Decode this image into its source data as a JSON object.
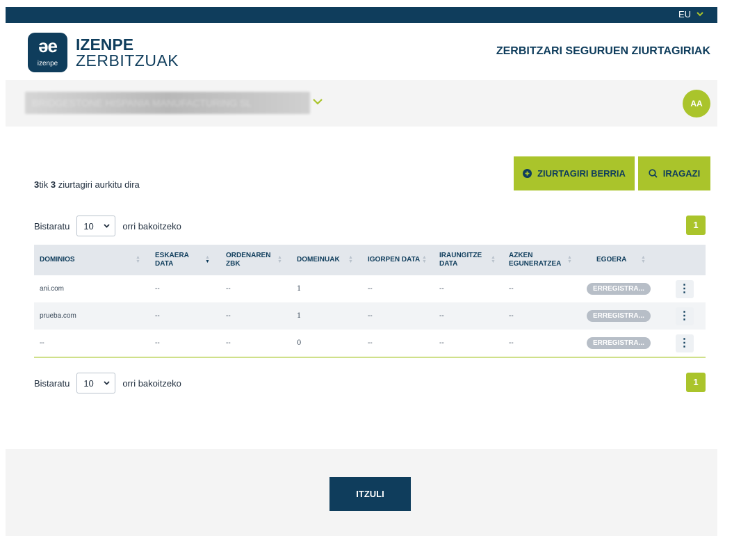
{
  "topbar": {
    "language": "EU"
  },
  "brand": {
    "logo_glyph": "əe",
    "logo_small": "izenpe",
    "line1": "IZENPE",
    "line2": "ZERBITZUAK"
  },
  "header": {
    "title": "ZERBITZARI SEGURUEN ZIURTAGIRIAK"
  },
  "org": {
    "name": "BRIDGESTONE HISPANIA MANUFACTURING SL",
    "avatar_initials": "AA"
  },
  "results": {
    "total": "3",
    "shown": "3",
    "mid": "tik ",
    "suffix": " ziurtagiri aurkitu dira"
  },
  "buttons": {
    "new_cert": "ZIURTAGIRI BERRIA",
    "filter": "IRAGAZI",
    "back": "ITZULI"
  },
  "pagination": {
    "prefix": "Bistaratu",
    "page_size": "10",
    "suffix": "orri bakoitzeko",
    "current_page": "1"
  },
  "table": {
    "columns": [
      {
        "l1": "DOMINIOS",
        "l2": ""
      },
      {
        "l1": "ESKAERA",
        "l2": "DATA"
      },
      {
        "l1": "ORDENAREN",
        "l2": "ZBK"
      },
      {
        "l1": "DOMEINUAK",
        "l2": ""
      },
      {
        "l1": "IGORPEN DATA",
        "l2": ""
      },
      {
        "l1": "IRAUNGITZE",
        "l2": "DATA"
      },
      {
        "l1": "AZKEN",
        "l2": "EGUNERATZEA"
      },
      {
        "l1": "EGOERA",
        "l2": ""
      }
    ],
    "rows": [
      {
        "dominios": "ani.com",
        "eskaera": "--",
        "ordenaren": "--",
        "domeinuak": "1",
        "igorpen": "--",
        "iraungitze": "--",
        "azken": "--",
        "egoera": "ERREGISTRA..."
      },
      {
        "dominios": "prueba.com",
        "eskaera": "--",
        "ordenaren": "--",
        "domeinuak": "1",
        "igorpen": "--",
        "iraungitze": "--",
        "azken": "--",
        "egoera": "ERREGISTRA..."
      },
      {
        "dominios": "--",
        "eskaera": "--",
        "ordenaren": "--",
        "domeinuak": "0",
        "igorpen": "--",
        "iraungitze": "--",
        "azken": "--",
        "egoera": "ERREGISTRA..."
      }
    ]
  },
  "colors": {
    "navy": "#0f3d5c",
    "accent_green": "#aac42b",
    "status_grey": "#b7bec7"
  }
}
